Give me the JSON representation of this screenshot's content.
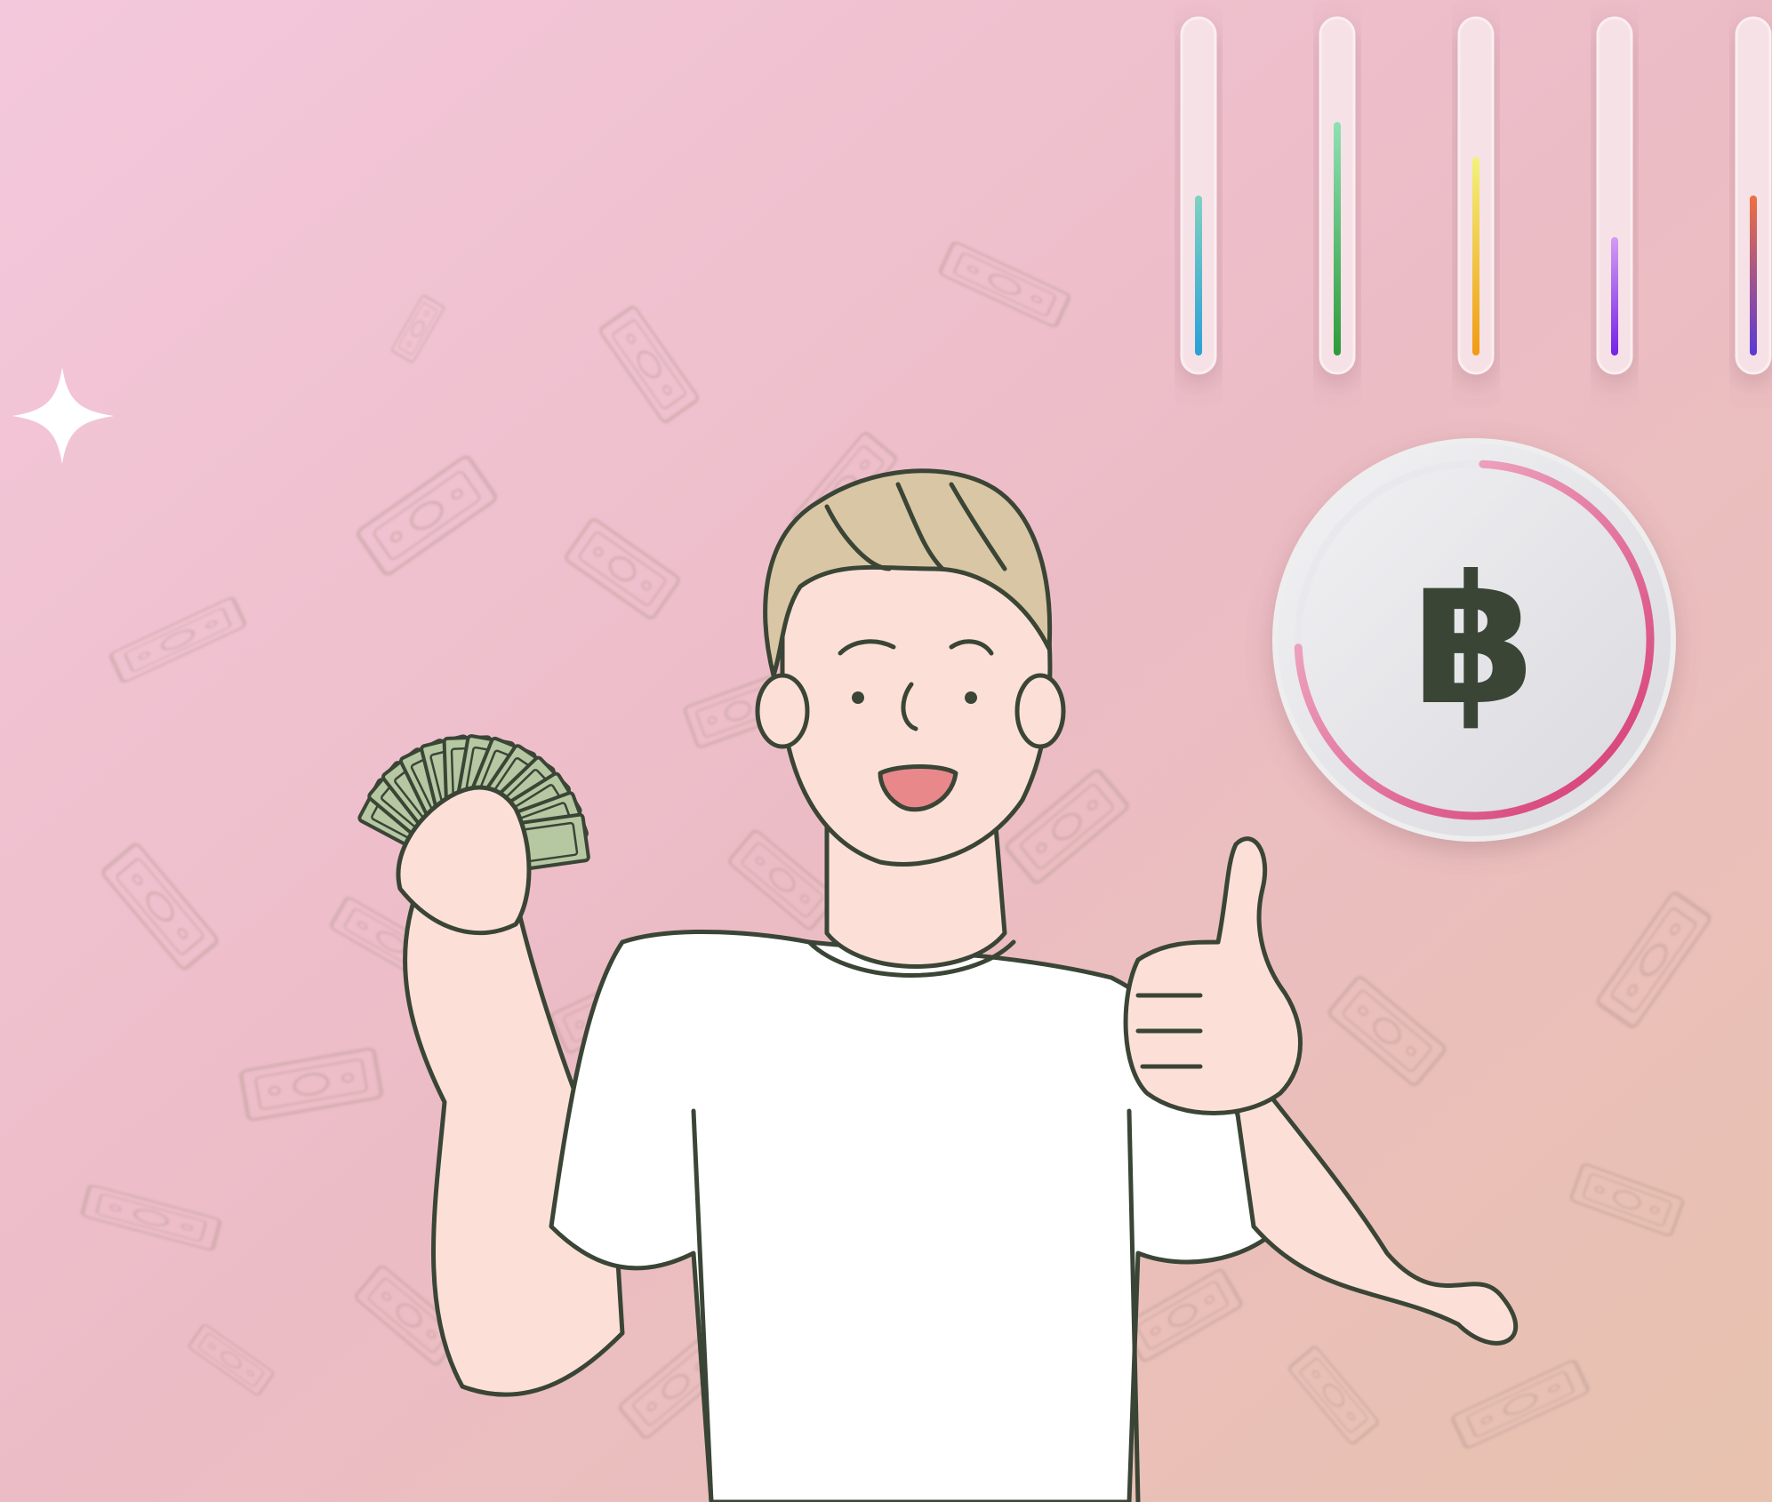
{
  "palette": {
    "bg_top": "#f4c8dc",
    "bg_mid": "#ecbcc6",
    "bg_bottom": "#e8c2ae",
    "ink": "#3a4536",
    "skin": "#fce0d8",
    "hair": "#d9c6a4",
    "cash_green": "#b6c8a2",
    "bill_ghost": "#b79a93",
    "sparkle": "#ffffff",
    "coin_face": "#e9e8ec",
    "coin_ring": "#d43472"
  },
  "meters": [
    {
      "name": "meter-1",
      "level": 0.5,
      "color_top": "#7fd2c2",
      "color_bottom": "#2aa0d8"
    },
    {
      "name": "meter-2",
      "level": 0.73,
      "color_top": "#8fe0b4",
      "color_bottom": "#2f9a3a"
    },
    {
      "name": "meter-3",
      "level": 0.62,
      "color_top": "#f2f27a",
      "color_bottom": "#f29a14"
    },
    {
      "name": "meter-4",
      "level": 0.37,
      "color_top": "#d39cf2",
      "color_bottom": "#7422e6"
    },
    {
      "name": "meter-5",
      "level": 0.5,
      "color_top": "#ee7040",
      "color_bottom": "#5a3ad6"
    }
  ],
  "coin": {
    "symbol": "฿",
    "progress": 0.75
  },
  "icons": {
    "sparkle": "sparkle-icon",
    "coin": "bitcoin-coin-icon",
    "character": "man-holding-cash-thumbs-up",
    "background": "falling-banknotes"
  }
}
